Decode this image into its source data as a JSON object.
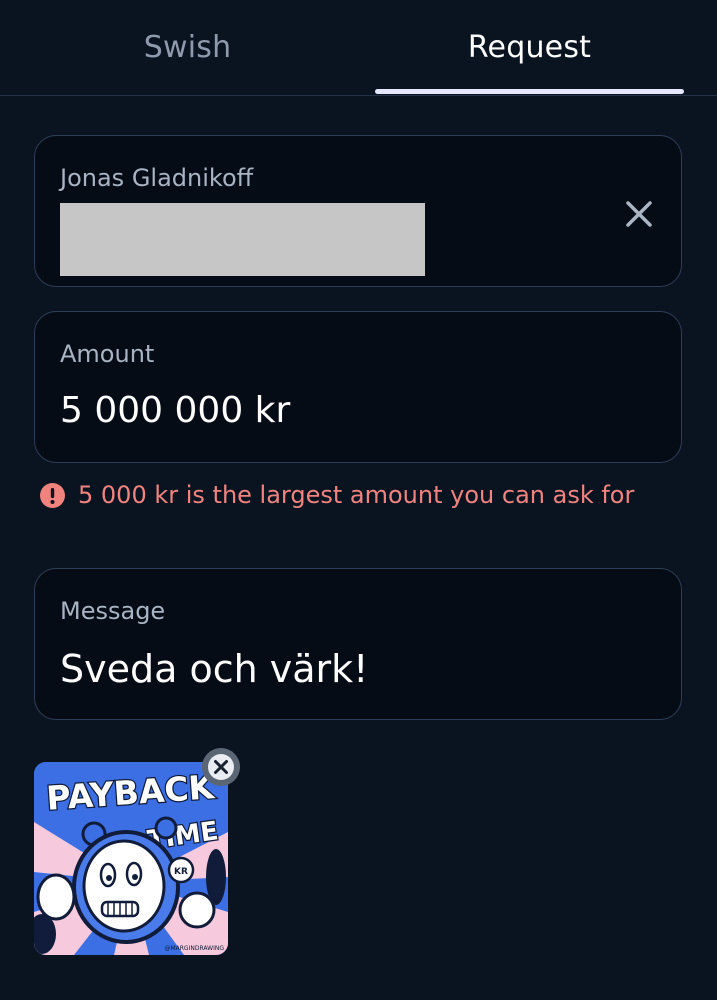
{
  "tabs": [
    {
      "label": "Swish",
      "active": false
    },
    {
      "label": "Request",
      "active": true
    }
  ],
  "recipient": {
    "name": "Jonas Gladnikoff"
  },
  "amount": {
    "label": "Amount",
    "value": "5 000 000 kr"
  },
  "error": {
    "text": "5 000 kr is the largest amount you can ask for",
    "color": "#f1837e"
  },
  "message": {
    "label": "Message",
    "value": "Sveda och värk!"
  },
  "sticker": {
    "title_line1": "PAYBACK",
    "title_line2": "TIME",
    "clock_label": "KR",
    "credit": "@MARGINDRAWING"
  },
  "colors": {
    "background": "#0a1421",
    "field_border": "#2f3e57",
    "tab_indicator": "#e6e6ff",
    "error": "#f1837e"
  }
}
